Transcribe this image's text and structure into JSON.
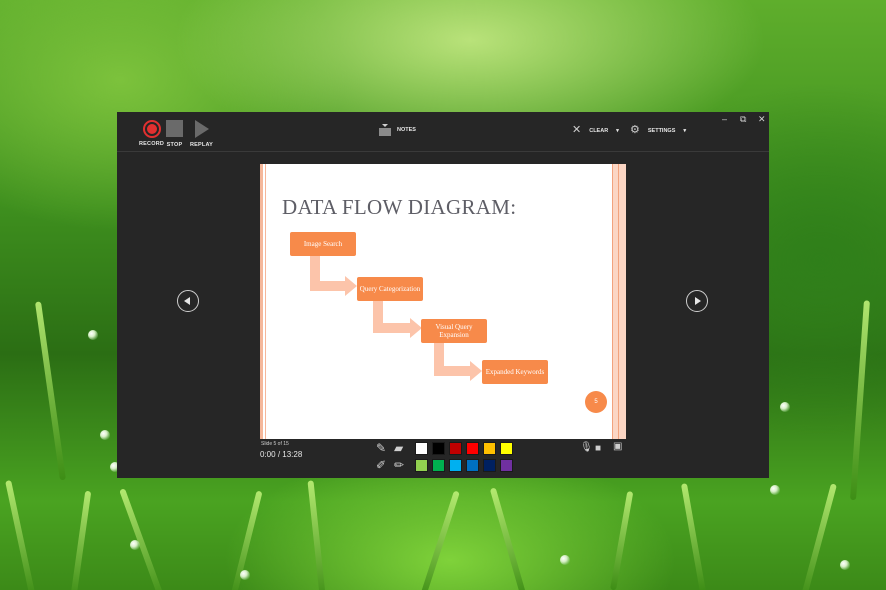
{
  "toolbar": {
    "record_label": "RECORD",
    "stop_label": "STOP",
    "replay_label": "REPLAY",
    "notes_label": "NOTES",
    "clear_label": "CLEAR",
    "settings_label": "SETTINGS",
    "icons": [
      "record-icon",
      "stop-icon",
      "replay-icon",
      "notes-icon",
      "clear-icon",
      "settings-icon"
    ]
  },
  "window_controls": {
    "minimize": "–",
    "restore": "⧉",
    "close": "✕"
  },
  "slide": {
    "title": "DATA FLOW DIAGRAM:",
    "boxes": [
      {
        "label": "Image Search"
      },
      {
        "label": "Query Categorization"
      },
      {
        "label": "Visual Query Expansion"
      },
      {
        "label": "Expanded Keywords"
      }
    ],
    "page_number": "5",
    "accent_color": "#f78a4a",
    "arrow_color": "#fcc4aa"
  },
  "status": {
    "slide_counter": "Slide 5 of 15",
    "elapsed": "0:00",
    "separator": "/",
    "total": "13:28"
  },
  "ink": {
    "tools": [
      "pen-icon",
      "eraser-icon",
      "highlighter-icon",
      "pencil-icon"
    ],
    "colors_row1": [
      "#ffffff",
      "#000000",
      "#c00000",
      "#ff0000",
      "#ffc000",
      "#ffff00"
    ],
    "colors_row2": [
      "#92d050",
      "#00b050",
      "#00b0f0",
      "#0070c0",
      "#002060",
      "#7030a0"
    ]
  },
  "media": {
    "icons": [
      "microphone-icon",
      "camera-icon",
      "camera-preview-icon"
    ]
  }
}
